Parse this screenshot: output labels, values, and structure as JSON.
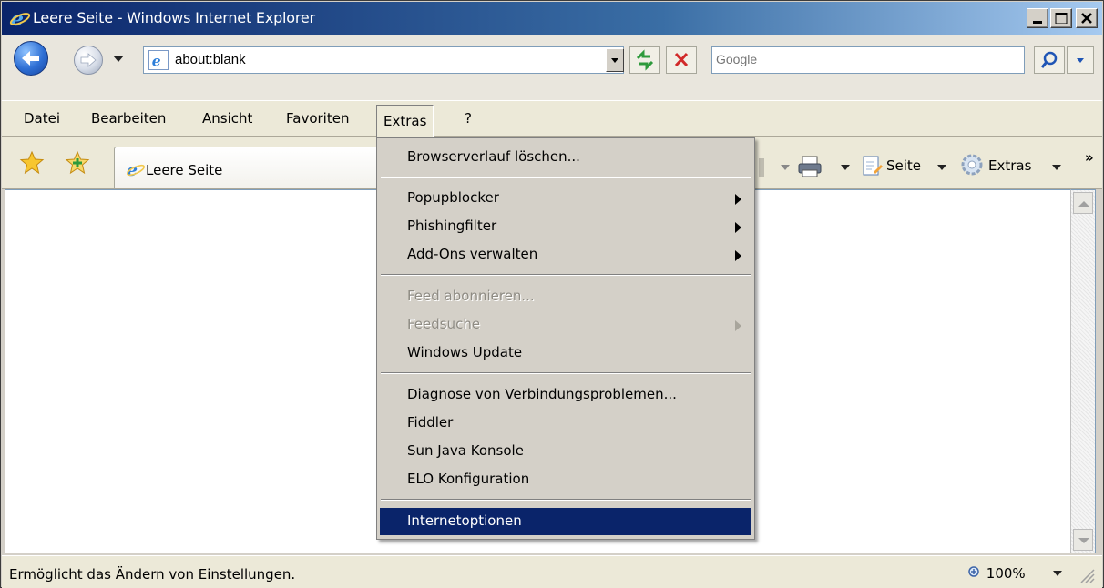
{
  "window": {
    "title": "Leere Seite - Windows Internet Explorer"
  },
  "address": {
    "url": "about:blank",
    "search_placeholder": "Google"
  },
  "menubar": {
    "items": [
      "Datei",
      "Bearbeiten",
      "Ansicht",
      "Favoriten",
      "Extras",
      "?"
    ]
  },
  "tab": {
    "label": "Leere Seite"
  },
  "commandbar": {
    "page": "Seite",
    "tools": "Extras",
    "more": "»"
  },
  "extras_menu": {
    "items": [
      {
        "label": "Browserverlauf löschen...",
        "enabled": true,
        "submenu": false
      },
      {
        "label": "Popupblocker",
        "enabled": true,
        "submenu": true
      },
      {
        "label": "Phishingfilter",
        "enabled": true,
        "submenu": true
      },
      {
        "label": "Add-Ons verwalten",
        "enabled": true,
        "submenu": true
      },
      {
        "label": "Feed abonnieren...",
        "enabled": false,
        "submenu": false
      },
      {
        "label": "Feedsuche",
        "enabled": false,
        "submenu": true
      },
      {
        "label": "Windows Update",
        "enabled": true,
        "submenu": false
      },
      {
        "label": "Diagnose von Verbindungsproblemen...",
        "enabled": true,
        "submenu": false
      },
      {
        "label": "Fiddler",
        "enabled": true,
        "submenu": false
      },
      {
        "label": "Sun Java Konsole",
        "enabled": true,
        "submenu": false
      },
      {
        "label": "ELO Konfiguration",
        "enabled": true,
        "submenu": false
      },
      {
        "label": "Internetoptionen",
        "enabled": true,
        "submenu": false,
        "selected": true
      }
    ]
  },
  "statusbar": {
    "text": "Ermöglicht das Ändern von Einstellungen.",
    "zoom": "100%"
  },
  "colors": {
    "title_gradient_start": "#0a246a",
    "menu_highlight": "#0a246a",
    "chrome": "#ece9d8"
  }
}
